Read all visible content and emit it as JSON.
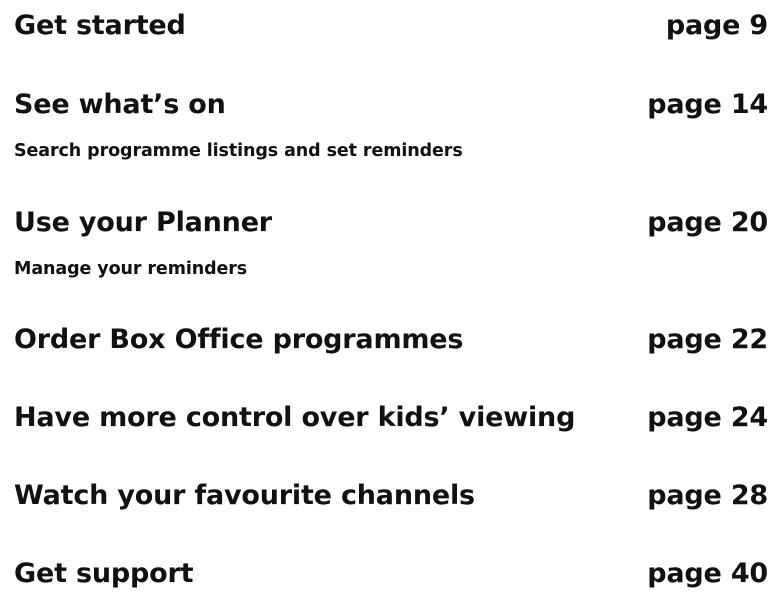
{
  "toc": {
    "entries": [
      {
        "title": "Get started",
        "page": "page 9",
        "subtitle": ""
      },
      {
        "title": "See what’s on",
        "page": "page 14",
        "subtitle": "Search programme listings and set reminders"
      },
      {
        "title": "Use your Planner",
        "page": "page 20",
        "subtitle": "Manage your reminders"
      },
      {
        "title": "Order Box Office programmes",
        "page": "page 22",
        "subtitle": ""
      },
      {
        "title": "Have more control over kids’ viewing",
        "page": "page 24",
        "subtitle": ""
      },
      {
        "title": "Watch your favourite channels",
        "page": "page 28",
        "subtitle": ""
      },
      {
        "title": "Get support",
        "page": "page 40",
        "subtitle": ""
      }
    ]
  }
}
